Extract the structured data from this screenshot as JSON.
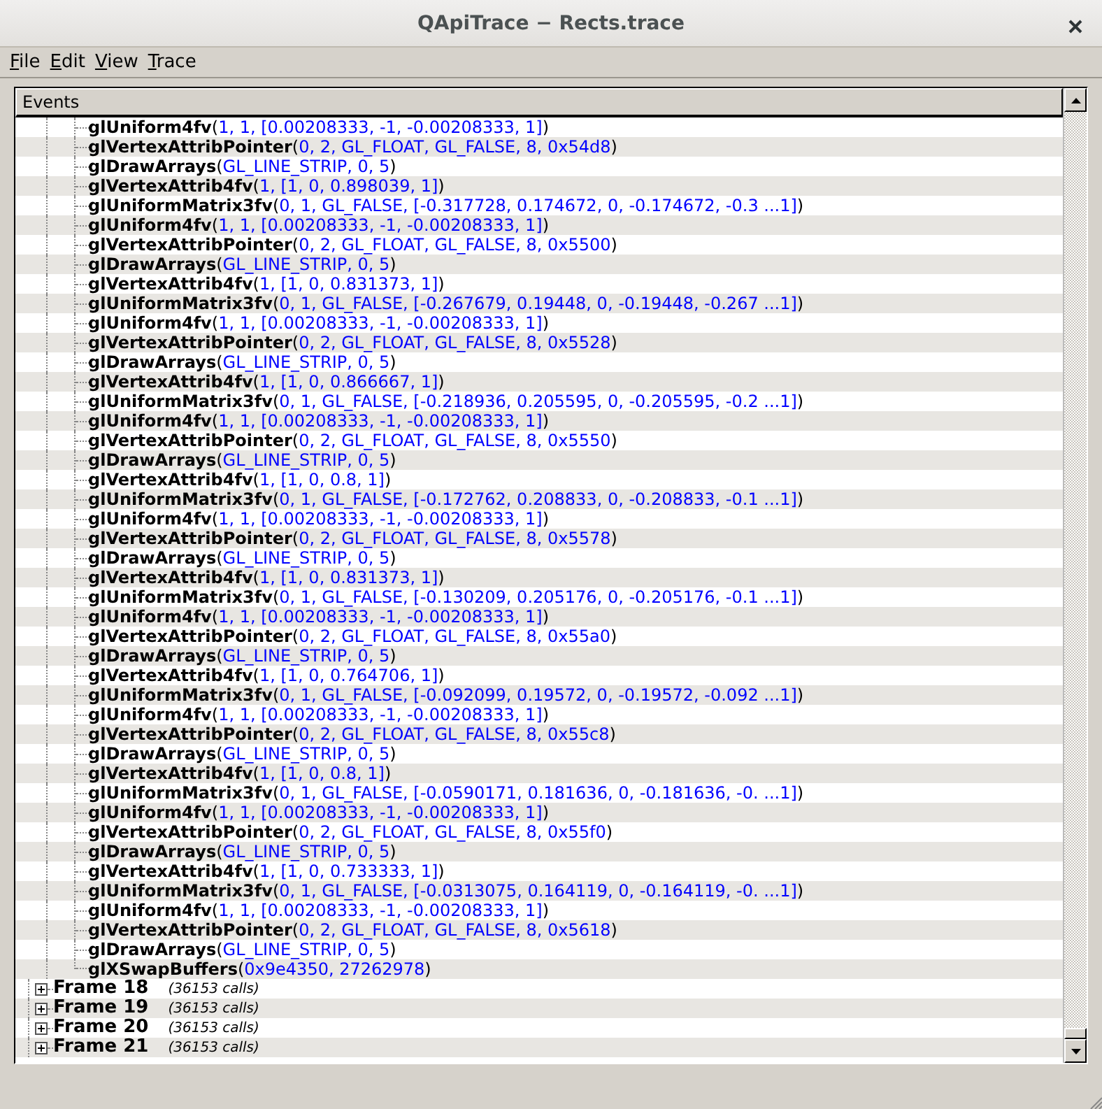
{
  "window": {
    "title": "QApiTrace − Rects.trace"
  },
  "menu": [
    "File",
    "Edit",
    "View",
    "Trace"
  ],
  "events": {
    "header": "Events",
    "calls": [
      {
        "name": "glUniform4fv",
        "args": "(1, 1, [0.00208333, -1, -0.00208333, 1])"
      },
      {
        "name": "glVertexAttribPointer",
        "args": "(0, 2, GL_FLOAT, GL_FALSE, 8, 0x54d8)"
      },
      {
        "name": "glDrawArrays",
        "args": "(GL_LINE_STRIP, 0, 5)"
      },
      {
        "name": "glVertexAttrib4fv",
        "args": "(1, [1, 0, 0.898039, 1])"
      },
      {
        "name": "glUniformMatrix3fv",
        "args": "(0, 1, GL_FALSE, [-0.317728, 0.174672, 0, -0.174672, -0.3 ...1])"
      },
      {
        "name": "glUniform4fv",
        "args": "(1, 1, [0.00208333, -1, -0.00208333, 1])"
      },
      {
        "name": "glVertexAttribPointer",
        "args": "(0, 2, GL_FLOAT, GL_FALSE, 8, 0x5500)"
      },
      {
        "name": "glDrawArrays",
        "args": "(GL_LINE_STRIP, 0, 5)"
      },
      {
        "name": "glVertexAttrib4fv",
        "args": "(1, [1, 0, 0.831373, 1])"
      },
      {
        "name": "glUniformMatrix3fv",
        "args": "(0, 1, GL_FALSE, [-0.267679, 0.19448, 0, -0.19448, -0.267 ...1])"
      },
      {
        "name": "glUniform4fv",
        "args": "(1, 1, [0.00208333, -1, -0.00208333, 1])"
      },
      {
        "name": "glVertexAttribPointer",
        "args": "(0, 2, GL_FLOAT, GL_FALSE, 8, 0x5528)"
      },
      {
        "name": "glDrawArrays",
        "args": "(GL_LINE_STRIP, 0, 5)"
      },
      {
        "name": "glVertexAttrib4fv",
        "args": "(1, [1, 0, 0.866667, 1])"
      },
      {
        "name": "glUniformMatrix3fv",
        "args": "(0, 1, GL_FALSE, [-0.218936, 0.205595, 0, -0.205595, -0.2 ...1])"
      },
      {
        "name": "glUniform4fv",
        "args": "(1, 1, [0.00208333, -1, -0.00208333, 1])"
      },
      {
        "name": "glVertexAttribPointer",
        "args": "(0, 2, GL_FLOAT, GL_FALSE, 8, 0x5550)"
      },
      {
        "name": "glDrawArrays",
        "args": "(GL_LINE_STRIP, 0, 5)"
      },
      {
        "name": "glVertexAttrib4fv",
        "args": "(1, [1, 0, 0.8, 1])"
      },
      {
        "name": "glUniformMatrix3fv",
        "args": "(0, 1, GL_FALSE, [-0.172762, 0.208833, 0, -0.208833, -0.1 ...1])"
      },
      {
        "name": "glUniform4fv",
        "args": "(1, 1, [0.00208333, -1, -0.00208333, 1])"
      },
      {
        "name": "glVertexAttribPointer",
        "args": "(0, 2, GL_FLOAT, GL_FALSE, 8, 0x5578)"
      },
      {
        "name": "glDrawArrays",
        "args": "(GL_LINE_STRIP, 0, 5)"
      },
      {
        "name": "glVertexAttrib4fv",
        "args": "(1, [1, 0, 0.831373, 1])"
      },
      {
        "name": "glUniformMatrix3fv",
        "args": "(0, 1, GL_FALSE, [-0.130209, 0.205176, 0, -0.205176, -0.1 ...1])"
      },
      {
        "name": "glUniform4fv",
        "args": "(1, 1, [0.00208333, -1, -0.00208333, 1])"
      },
      {
        "name": "glVertexAttribPointer",
        "args": "(0, 2, GL_FLOAT, GL_FALSE, 8, 0x55a0)"
      },
      {
        "name": "glDrawArrays",
        "args": "(GL_LINE_STRIP, 0, 5)"
      },
      {
        "name": "glVertexAttrib4fv",
        "args": "(1, [1, 0, 0.764706, 1])"
      },
      {
        "name": "glUniformMatrix3fv",
        "args": "(0, 1, GL_FALSE, [-0.092099, 0.19572, 0, -0.19572, -0.092 ...1])"
      },
      {
        "name": "glUniform4fv",
        "args": "(1, 1, [0.00208333, -1, -0.00208333, 1])"
      },
      {
        "name": "glVertexAttribPointer",
        "args": "(0, 2, GL_FLOAT, GL_FALSE, 8, 0x55c8)"
      },
      {
        "name": "glDrawArrays",
        "args": "(GL_LINE_STRIP, 0, 5)"
      },
      {
        "name": "glVertexAttrib4fv",
        "args": "(1, [1, 0, 0.8, 1])"
      },
      {
        "name": "glUniformMatrix3fv",
        "args": "(0, 1, GL_FALSE, [-0.0590171, 0.181636, 0, -0.181636, -0. ...1])"
      },
      {
        "name": "glUniform4fv",
        "args": "(1, 1, [0.00208333, -1, -0.00208333, 1])"
      },
      {
        "name": "glVertexAttribPointer",
        "args": "(0, 2, GL_FLOAT, GL_FALSE, 8, 0x55f0)"
      },
      {
        "name": "glDrawArrays",
        "args": "(GL_LINE_STRIP, 0, 5)"
      },
      {
        "name": "glVertexAttrib4fv",
        "args": "(1, [1, 0, 0.733333, 1])"
      },
      {
        "name": "glUniformMatrix3fv",
        "args": "(0, 1, GL_FALSE, [-0.0313075, 0.164119, 0, -0.164119, -0. ...1])"
      },
      {
        "name": "glUniform4fv",
        "args": "(1, 1, [0.00208333, -1, -0.00208333, 1])"
      },
      {
        "name": "glVertexAttribPointer",
        "args": "(0, 2, GL_FLOAT, GL_FALSE, 8, 0x5618)"
      },
      {
        "name": "glDrawArrays",
        "args": "(GL_LINE_STRIP, 0, 5)"
      },
      {
        "name": "glXSwapBuffers",
        "args": "(0x9e4350, 27262978)"
      }
    ],
    "frames": [
      {
        "label": "Frame 18",
        "calls": "(36153 calls)",
        "expanded": false
      },
      {
        "label": "Frame 19",
        "calls": "(36153 calls)",
        "expanded": false
      },
      {
        "label": "Frame 20",
        "calls": "(36153 calls)",
        "expanded": false
      },
      {
        "label": "Frame 21",
        "calls": "(36153 calls)",
        "expanded": false
      }
    ]
  }
}
